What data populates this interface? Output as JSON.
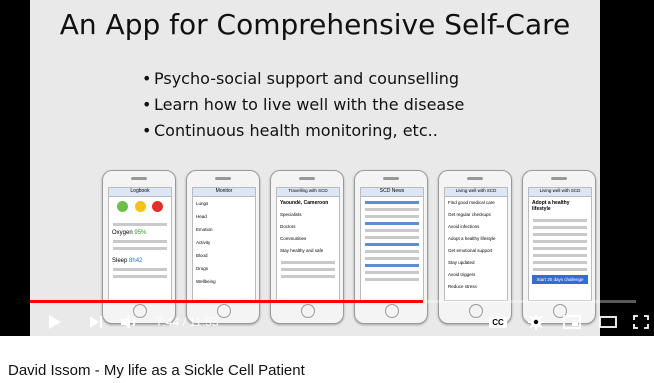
{
  "slide": {
    "title": "An App for Comprehensive Self-Care",
    "bullets": [
      "Psycho-social support and counselling",
      "Learn how to live well with the disease",
      "Continuous health monitoring, etc.."
    ],
    "phones": [
      {
        "header": "Logbook",
        "label_a": "Oxygen",
        "value_a": "95%",
        "label_b": "Sleep",
        "value_b": "8h42"
      },
      {
        "header": "Monitor",
        "rows": [
          "Lungs",
          "Head",
          "Emotion",
          "Activity",
          "Blood",
          "Drugs",
          "Wellbeing"
        ]
      },
      {
        "header": "Travelling with SCD",
        "city": "Yaoundé, Cameroon",
        "rows": [
          "Specialists",
          "Doctors",
          "Communities"
        ],
        "note": "Stay healthy and safe"
      },
      {
        "header": "SCD News"
      },
      {
        "header": "Living well with SCD",
        "rows": [
          "Find good medical care",
          "Get regular checkups",
          "Avoid infections",
          "Adopt a healthy lifestyle",
          "Get emotional support",
          "Stay updated",
          "Avoid triggers",
          "Reduce stress"
        ]
      },
      {
        "header": "Living well with SCD",
        "subheader": "Adopt a healthy lifestyle",
        "cta": "Start 30 days challenge"
      }
    ]
  },
  "player": {
    "current_time": "7:44",
    "separator": " / ",
    "duration": "11:55",
    "progress_fraction": 0.649,
    "cc_label": "CC",
    "accent_color": "#ff0000"
  },
  "video": {
    "title": "David Issom - My life as a Sickle Cell Patient"
  }
}
